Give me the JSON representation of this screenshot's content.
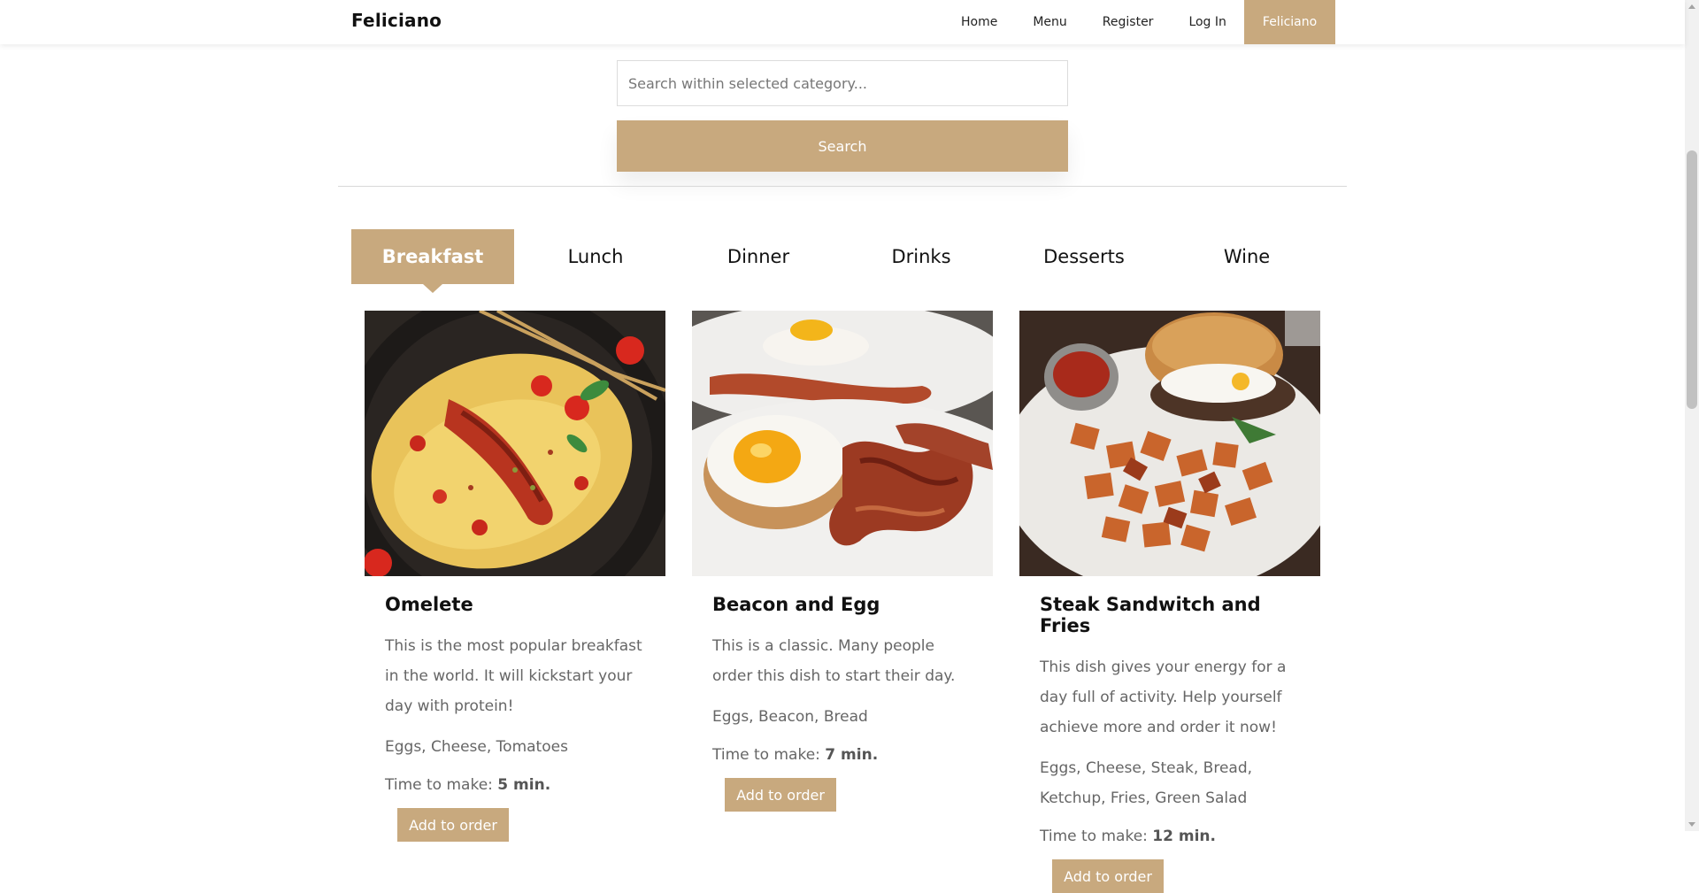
{
  "navbar": {
    "brand": "Feliciano",
    "links": [
      "Home",
      "Menu",
      "Register",
      "Log In",
      "Feliciano"
    ],
    "active_index": 4
  },
  "search": {
    "placeholder": "Search within selected category...",
    "button_label": "Search"
  },
  "tabs": {
    "items": [
      "Breakfast",
      "Lunch",
      "Dinner",
      "Drinks",
      "Desserts",
      "Wine"
    ],
    "active_index": 0
  },
  "cards": [
    {
      "title": "Omelete",
      "description": "This is the most popular breakfast in the world. It will kickstart your day with protein!",
      "ingredients": "Eggs, Cheese, Tomatoes",
      "time_label": "Time to make:",
      "time_value": "5 min.",
      "button_label": "Add to order",
      "image": "omelette-photo"
    },
    {
      "title": "Beacon and Egg",
      "description": "This is a classic. Many people order this dish to start their day.",
      "ingredients": "Eggs, Beacon, Bread",
      "time_label": "Time to make:",
      "time_value": "7 min.",
      "button_label": "Add to order",
      "image": "bacon-and-egg-photo"
    },
    {
      "title": "Steak Sandwitch and Fries",
      "description": "This dish gives your energy for a day full of activity. Help yourself achieve more and order it now!",
      "ingredients": "Eggs, Cheese, Steak, Bread, Ketchup, Fries, Green Salad",
      "time_label": "Time to make:",
      "time_value": "12 min.",
      "button_label": "Add to order",
      "image": "steak-sandwich-photo"
    }
  ],
  "colors": {
    "accent": "#c8a97e",
    "text_dark": "#111111",
    "text_muted": "#666666"
  }
}
